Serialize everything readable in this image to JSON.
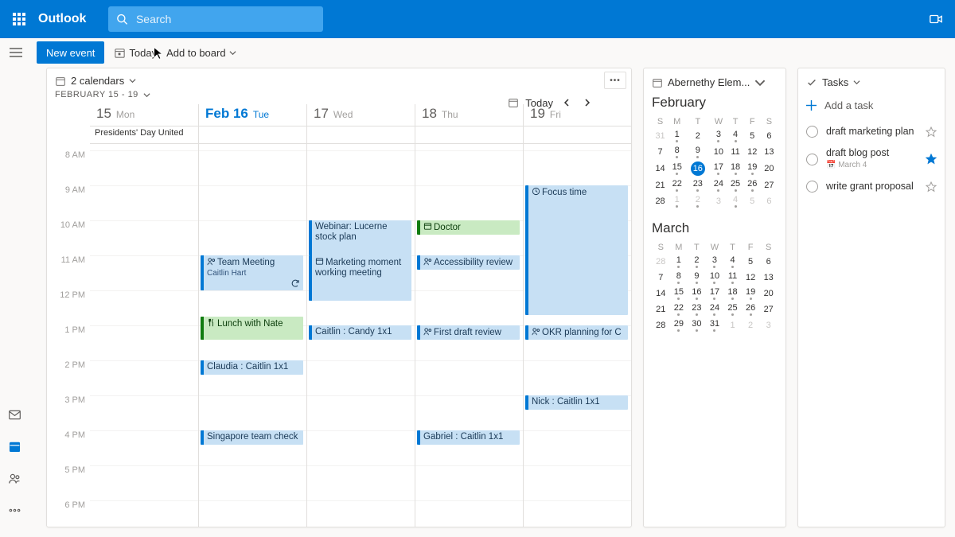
{
  "header": {
    "app": "Outlook",
    "search_placeholder": "Search"
  },
  "command": {
    "new_event": "New event",
    "today": "Today",
    "add_to_board": "Add to board"
  },
  "calendar_card": {
    "calendars_label": "2 calendars",
    "date_range": "FEBRUARY 15 - 19",
    "today_label": "Today"
  },
  "hours": [
    "8 AM",
    "9 AM",
    "10 AM",
    "11 AM",
    "12 PM",
    "1 PM",
    "2 PM",
    "3 PM",
    "4 PM",
    "5 PM",
    "6 PM"
  ],
  "days": [
    {
      "num": "15",
      "dow": "Mon",
      "today": false,
      "allday": "Presidents' Day United"
    },
    {
      "num": "Feb 16",
      "dow": "Tue",
      "today": true,
      "allday": ""
    },
    {
      "num": "17",
      "dow": "Wed",
      "today": false,
      "allday": ""
    },
    {
      "num": "18",
      "dow": "Thu",
      "today": false,
      "allday": ""
    },
    {
      "num": "19",
      "dow": "Fri",
      "today": false,
      "allday": ""
    }
  ],
  "events": {
    "d1": {
      "team_meeting": {
        "title": "Team Meeting",
        "sub": "Caitlin Hart"
      },
      "lunch": {
        "title": "Lunch with Nate"
      },
      "claudia": {
        "title": "Claudia : Caitlin 1x1"
      },
      "singapore": {
        "title": "Singapore team check"
      }
    },
    "d2": {
      "webinar": {
        "title": "Webinar: Lucerne stock plan"
      },
      "marketing": {
        "title": "Marketing moment working meeting"
      },
      "candy": {
        "title": "Caitlin : Candy 1x1"
      }
    },
    "d3": {
      "doctor": {
        "title": "Doctor"
      },
      "access": {
        "title": "Accessibility review"
      },
      "draft": {
        "title": "First draft review"
      },
      "gabriel": {
        "title": "Gabriel : Caitlin 1x1"
      }
    },
    "d4": {
      "focus": {
        "title": "Focus time"
      },
      "okr": {
        "title": "OKR planning for C"
      },
      "nick": {
        "title": "Nick : Caitlin 1x1"
      }
    }
  },
  "mini": {
    "source": "Abernethy Elem...",
    "feb_label": "February",
    "mar_label": "March",
    "dow": [
      "S",
      "M",
      "T",
      "W",
      "T",
      "F",
      "S"
    ]
  },
  "feb_rows": [
    [
      "31",
      "1",
      "2",
      "3",
      "4",
      "5",
      "6"
    ],
    [
      "7",
      "8",
      "9",
      "10",
      "11",
      "12",
      "13"
    ],
    [
      "14",
      "15",
      "16",
      "17",
      "18",
      "19",
      "20"
    ],
    [
      "21",
      "22",
      "23",
      "24",
      "25",
      "26",
      "27"
    ],
    [
      "28",
      "1",
      "2",
      "3",
      "4",
      "5",
      "6"
    ]
  ],
  "mar_rows": [
    [
      "28",
      "1",
      "2",
      "3",
      "4",
      "5",
      "6"
    ],
    [
      "7",
      "8",
      "9",
      "10",
      "11",
      "12",
      "13"
    ],
    [
      "14",
      "15",
      "16",
      "17",
      "18",
      "19",
      "20"
    ],
    [
      "21",
      "22",
      "23",
      "24",
      "25",
      "26",
      "27"
    ],
    [
      "28",
      "29",
      "30",
      "31",
      "1",
      "2",
      "3"
    ]
  ],
  "tasks": {
    "header": "Tasks",
    "add": "Add a task",
    "items": [
      {
        "label": "draft marketing plan",
        "due": "",
        "starred": false
      },
      {
        "label": "draft blog post",
        "due": "March 4",
        "starred": true
      },
      {
        "label": "write grant proposal",
        "due": "",
        "starred": false
      }
    ]
  }
}
